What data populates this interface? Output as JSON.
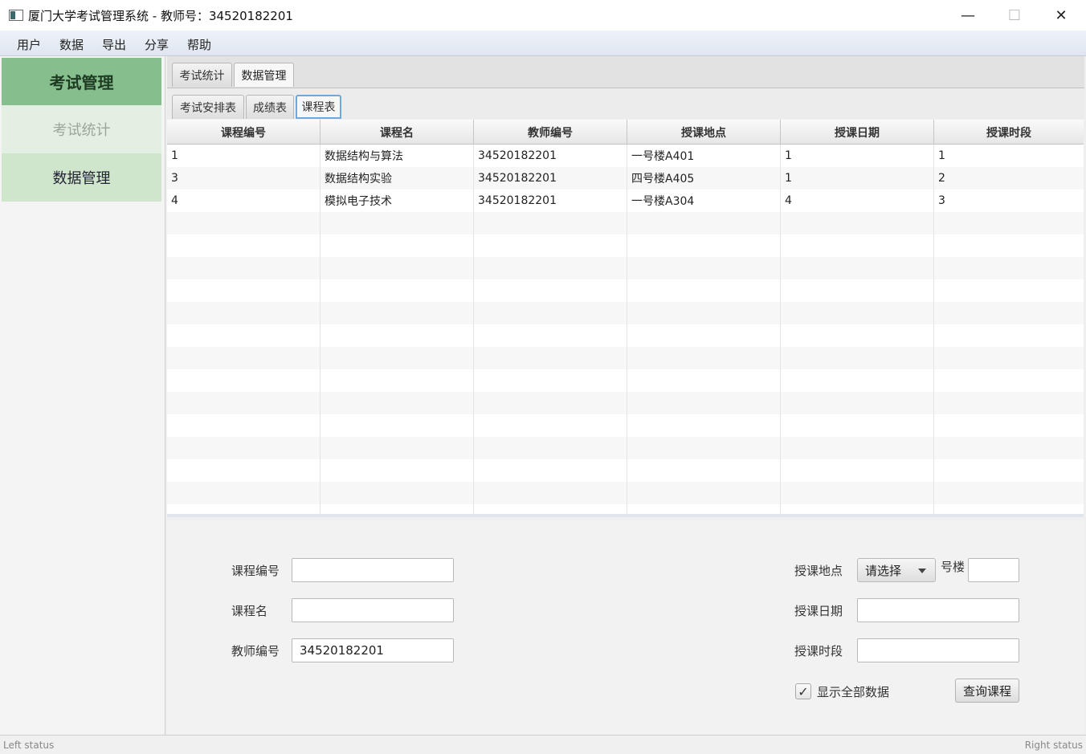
{
  "window": {
    "title": "厦门大学考试管理系统 - 教师号：34520182201",
    "minimize_glyph": "—",
    "maximize_glyph": "☐",
    "close_glyph": "✕"
  },
  "menu": [
    "用户",
    "数据",
    "导出",
    "分享",
    "帮助"
  ],
  "nav": {
    "header": "考试管理",
    "items": [
      "考试统计",
      "数据管理"
    ]
  },
  "outer_tabs": [
    "考试统计",
    "数据管理"
  ],
  "inner_tabs": [
    "考试安排表",
    "成绩表",
    "课程表"
  ],
  "table": {
    "columns": [
      "课程编号",
      "课程名",
      "教师编号",
      "授课地点",
      "授课日期",
      "授课时段"
    ],
    "rows": [
      [
        "1",
        "数据结构与算法",
        "34520182201",
        "一号楼A401",
        "1",
        "1"
      ],
      [
        "3",
        "数据结构实验",
        "34520182201",
        "四号楼A405",
        "1",
        "2"
      ],
      [
        "4",
        "模拟电子技术",
        "34520182201",
        "一号楼A304",
        "4",
        "3"
      ]
    ]
  },
  "form": {
    "course_id_label": "课程编号",
    "course_id_value": "",
    "course_name_label": "课程名",
    "course_name_value": "",
    "teacher_id_label": "教师编号",
    "teacher_id_value": "34520182201",
    "location_label": "授课地点",
    "location_select": "请选择",
    "building_suffix": "号楼",
    "building_value": "",
    "date_label": "授课日期",
    "date_value": "",
    "period_label": "授课时段",
    "period_value": "",
    "show_all_label": "显示全部数据",
    "show_all_checked": "✓",
    "query_button": "查询课程"
  },
  "status": {
    "left": "Left status",
    "right": "Right status"
  },
  "colors": {
    "nav_header": "#86bf8d",
    "nav_item_selected": "#cfe6cc",
    "nav_item_disabled": "#e4efe3",
    "focus_ring": "#6fa8dc"
  }
}
